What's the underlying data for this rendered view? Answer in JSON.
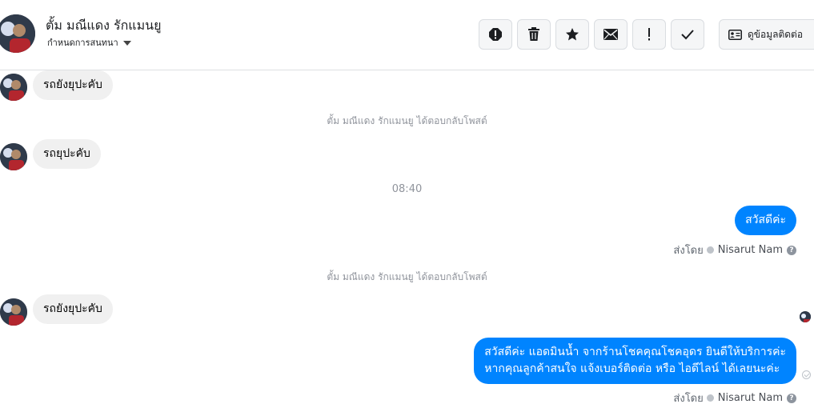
{
  "header": {
    "contact_name": "ตั้ม มณีแดง รักแมนยู",
    "settings_label": "กำหนดการสนทนา",
    "toolbar": {
      "spam_icon": "exclamation-octagon-icon",
      "delete_icon": "trash-icon",
      "star_icon": "star-icon",
      "unread_icon": "envelope-icon",
      "important_icon": "exclamation-icon",
      "done_icon": "check-icon"
    },
    "contact_info_label": "ดูข้อมูลติดต่อ"
  },
  "messages": {
    "in_1": "รถยังยุปะคับ",
    "note_1": "ตั้ม มณีแดง รักแมนยู ได้ตอบกลับโพสต์",
    "in_2": "รถยุปะคับ",
    "time_1": "08:40",
    "out_1": "สวัสดีค่ะ",
    "sent_by_label_1": "ส่งโดย",
    "sent_by_name_1": "Nisarut Nam",
    "note_2": "ตั้ม มณีแดง รักแมนยู ได้ตอบกลับโพสต์",
    "in_3": "รถยังยุปะคับ",
    "out_2_line_1": "สวัสดีค่ะ แอดมินน้ำ จากร้านโชคคุณโชคอุดร ยินดีให้บริการค่ะ",
    "out_2_line_2": "หากคุณลูกค้าสนใจ แจ้งเบอร์ติดต่อ หรือ ไอดีไลน์ ได้เลยนะค่ะ",
    "sent_by_label_2": "ส่งโดย",
    "sent_by_name_2": "Nisarut Nam"
  },
  "colors": {
    "outgoing_bubble": "#0084ff",
    "incoming_bubble": "#f0f0f0",
    "meta_text": "#90949c"
  }
}
